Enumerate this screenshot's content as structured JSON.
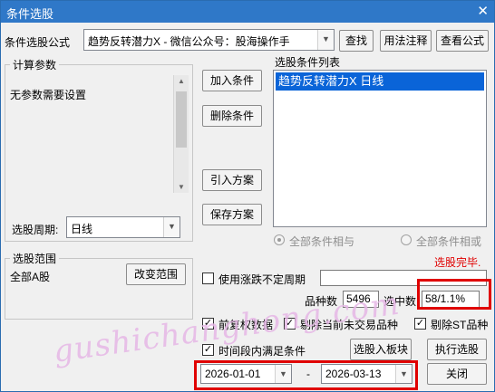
{
  "window": {
    "title": "条件选股",
    "close_glyph": "✕"
  },
  "formula": {
    "label": "条件选股公式",
    "value": "趋势反转潜力X  -  微信公众号：股海操作手",
    "find_button": "查找",
    "usage_button": "用法注释",
    "view_button": "查看公式"
  },
  "params": {
    "group_title": "计算参数",
    "message": "无参数需要设置",
    "period_label": "选股周期:",
    "period_value": "日线"
  },
  "buttons": {
    "add_condition": "加入条件",
    "delete_condition": "删除条件",
    "import_scheme": "引入方案",
    "save_scheme": "保存方案",
    "add_to_board": "选股入板块",
    "execute": "执行选股",
    "close": "关闭",
    "change_range": "改变范围"
  },
  "conditions": {
    "list_title": "选股条件列表",
    "items": [
      "趋势反转潜力X  日线"
    ],
    "radio_and": "全部条件相与",
    "radio_or": "全部条件相或"
  },
  "status": {
    "text": "选股完毕.",
    "color": "#e00000"
  },
  "range": {
    "group_title": "选股范围",
    "value": "全部A股"
  },
  "variable_period": {
    "label": "使用涨跌不定周期",
    "checked": false,
    "value": ""
  },
  "counts": {
    "varieties_label": "品种数",
    "varieties_value": "5496",
    "selected_label": "选中数",
    "selected_value": "58/1.1%"
  },
  "options": {
    "forward_adjust": {
      "label": "前复权数据",
      "checked": true
    },
    "exclude_untraded": {
      "label": "剔除当前未交易品种",
      "checked": true
    },
    "exclude_st": {
      "label": "剔除ST品种",
      "checked": true
    },
    "time_range": {
      "label": "时间段内满足条件",
      "checked": true
    }
  },
  "dates": {
    "start": "2026-01-01",
    "separator": "-",
    "end": "2026-03-13"
  },
  "watermark": "gushichanghong.com",
  "icons": {
    "dropdown": "chevron-down-icon",
    "checkmark": "check-icon"
  },
  "colors": {
    "title_bar": "#2f78c8",
    "selection": "#0a64d8",
    "highlight_box": "#e00000"
  }
}
